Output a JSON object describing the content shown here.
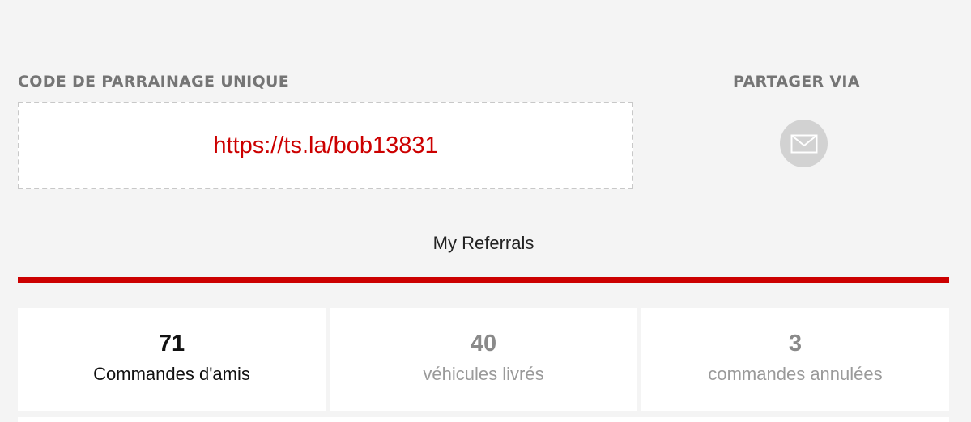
{
  "referral": {
    "code_heading": "CODE DE PARRAINAGE UNIQUE",
    "code_link": "https://ts.la/bob13831",
    "share_heading": "PARTAGER VIA",
    "share_icon": "email-icon"
  },
  "tabs": {
    "active_label": "My Referrals"
  },
  "stats": [
    {
      "value": "71",
      "label": "Commandes d'amis"
    },
    {
      "value": "40",
      "label": "véhicules livrés"
    },
    {
      "value": "3",
      "label": "commandes annulées"
    }
  ],
  "colors": {
    "accent": "#cc0000",
    "background": "#f4f4f4",
    "muted_text": "#9a9a9a",
    "icon_bg": "#d2d2d2"
  }
}
